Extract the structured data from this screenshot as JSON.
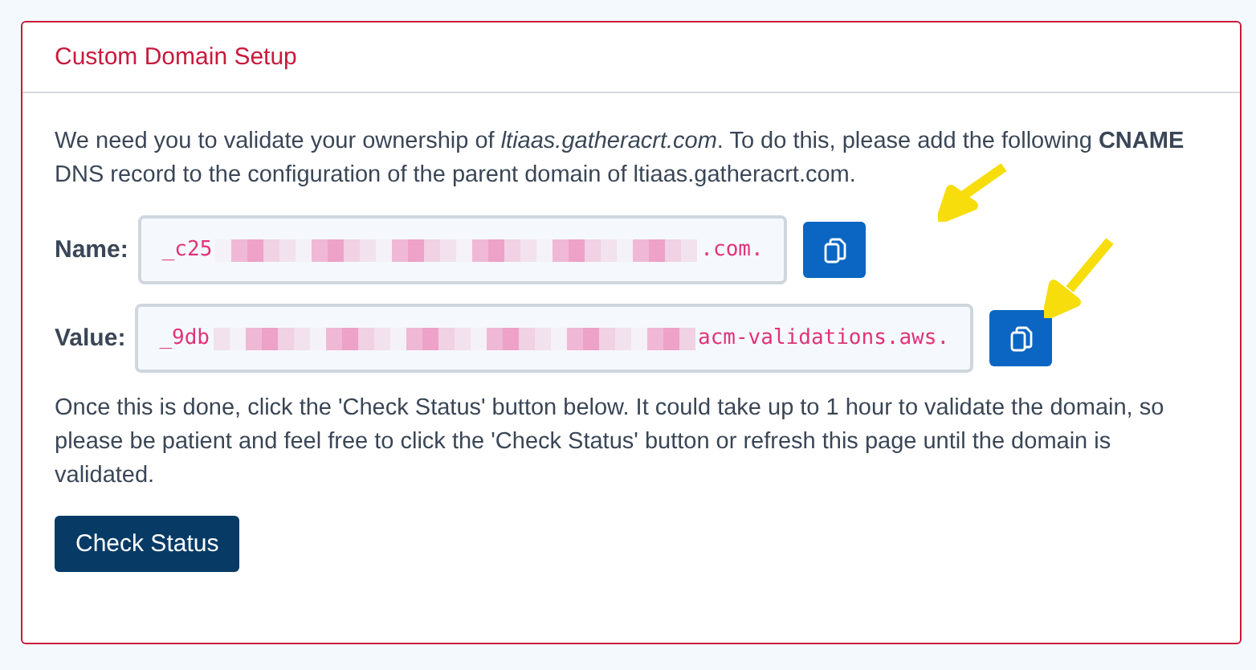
{
  "card": {
    "title": "Custom Domain Setup",
    "intro": "We need you to validate your ownership of *ltiaas.gatheracrt.com*. To do this, please add the following **CNAME** DNS record to the configuration of the parent domain of ltiaas.gatheracrt.com.",
    "records": [
      {
        "label": "Name:",
        "prefix": "_c25",
        "suffix": ".com."
      },
      {
        "label": "Value:",
        "prefix": "_9db",
        "suffix": "acm-validations.aws."
      }
    ],
    "note": "Once this is done, click the 'Check Status' button below. It could take up to 1 hour to validate the domain, so please be patient and feel free to click the 'Check Status' button or refresh this page until the domain is validated.",
    "button": "Check Status"
  }
}
